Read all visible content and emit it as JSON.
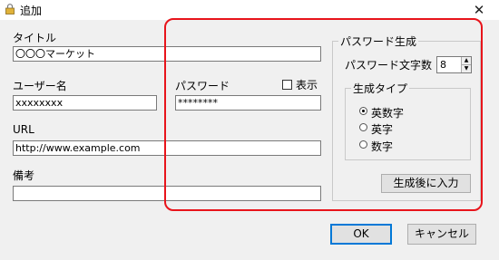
{
  "window": {
    "title": "追加",
    "close_glyph": "✕"
  },
  "form": {
    "title_label": "タイトル",
    "title_value": "〇〇〇マーケット",
    "username_label": "ユーザー名",
    "username_value": "xxxxxxxx",
    "password_label": "パスワード",
    "password_value": "********",
    "show_label": "表示",
    "show_checked": false,
    "url_label": "URL",
    "url_value": "http://www.example.com",
    "note_label": "備考",
    "note_value": ""
  },
  "generator": {
    "group_label": "パスワード生成",
    "length_label": "パスワード文字数",
    "length_value": "8",
    "type_group_label": "生成タイプ",
    "types": [
      {
        "label": "英数字",
        "selected": true
      },
      {
        "label": "英字",
        "selected": false
      },
      {
        "label": "数字",
        "selected": false
      }
    ],
    "generate_button": "生成後に入力"
  },
  "buttons": {
    "ok": "OK",
    "cancel": "キャンセル"
  },
  "colors": {
    "highlight": "#e8141b",
    "accent": "#0078d7"
  },
  "icons": {
    "app": "lock-icon",
    "close": "close-icon"
  }
}
